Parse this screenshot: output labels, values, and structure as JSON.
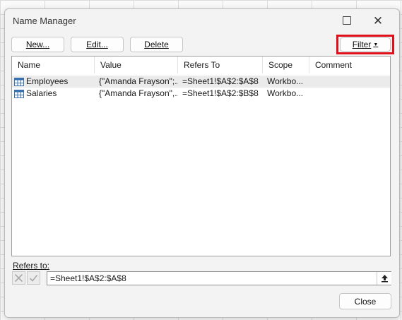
{
  "dialog": {
    "title": "Name Manager"
  },
  "toolbar": {
    "new_label": "New...",
    "edit_label": "Edit...",
    "delete_label": "Delete",
    "filter_label": "Filter"
  },
  "table": {
    "columns": [
      "Name",
      "Value",
      "Refers To",
      "Scope",
      "Comment"
    ],
    "rows": [
      {
        "name": "Employees",
        "value": "{\"Amanda Frayson\";...",
        "refers_to": "=Sheet1!$A$2:$A$8",
        "scope": "Workbo...",
        "comment": ""
      },
      {
        "name": "Salaries",
        "value": "{\"Amanda Frayson\",...",
        "refers_to": "=Sheet1!$A$2:$B$8",
        "scope": "Workbo...",
        "comment": ""
      }
    ]
  },
  "refers_to": {
    "label": "Refers to:",
    "value": "=Sheet1!$A$2:$A$8"
  },
  "footer": {
    "close_label": "Close"
  },
  "icons": {
    "table_row": "table-icon",
    "cancel": "cancel-x-icon",
    "confirm": "check-icon",
    "collapse": "collapse-dialog-icon"
  },
  "colors": {
    "highlight": "#e0101a",
    "selected_row": "#ebebeb"
  }
}
